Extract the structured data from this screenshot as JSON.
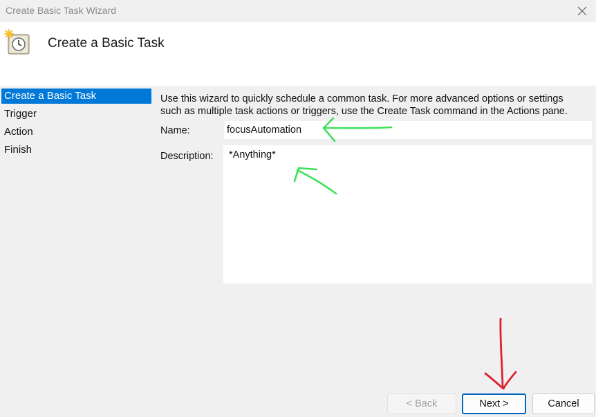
{
  "window": {
    "title": "Create Basic Task Wizard"
  },
  "header": {
    "title": "Create a Basic Task"
  },
  "sidebar": {
    "items": [
      {
        "label": "Create a Basic Task",
        "active": true
      },
      {
        "label": "Trigger",
        "active": false
      },
      {
        "label": "Action",
        "active": false
      },
      {
        "label": "Finish",
        "active": false
      }
    ]
  },
  "main": {
    "intro_line1": "Use this wizard to quickly schedule a common task.  For more advanced options or settings",
    "intro_line2": "such as multiple task actions or triggers, use the Create Task command in the Actions pane.",
    "name_label": "Name:",
    "name_value": "focusAutomation",
    "description_label": "Description:",
    "description_value": "*Anything*"
  },
  "buttons": {
    "back": "< Back",
    "next": "Next >",
    "cancel": "Cancel"
  },
  "colors": {
    "accent": "#0078d7",
    "annotation_green": "#3ee05a",
    "annotation_red": "#e0202c"
  }
}
